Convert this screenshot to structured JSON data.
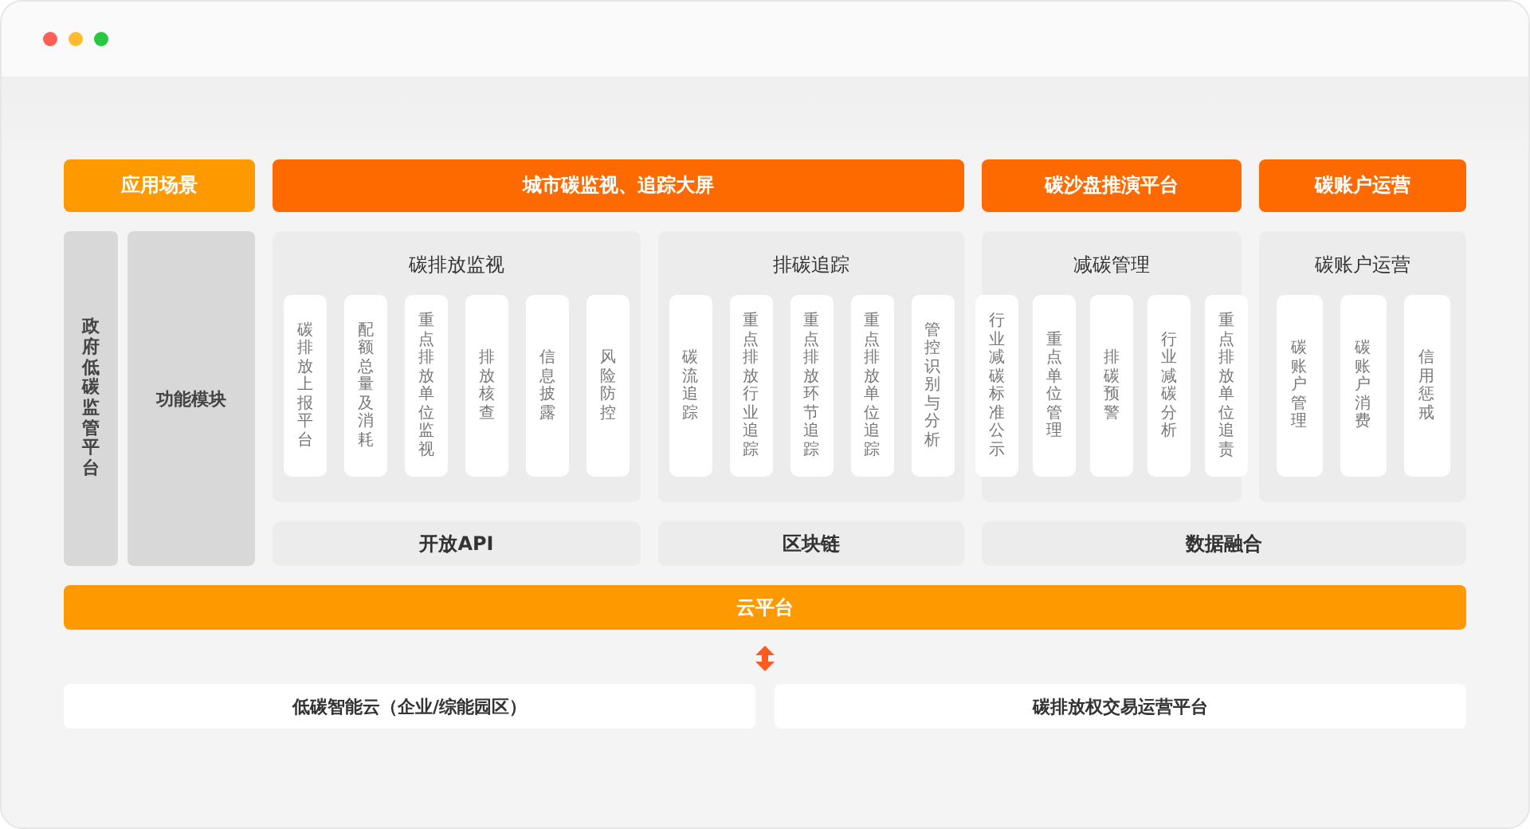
{
  "headers": [
    {
      "label": "应用场景",
      "color": "#ff9900"
    },
    {
      "label": "城市碳监视、追踪大屏",
      "color": "#ff6a00"
    },
    {
      "label": "碳沙盘推演平台",
      "color": "#ff6a00"
    },
    {
      "label": "碳账户运营",
      "color": "#ff6a00"
    }
  ],
  "side": {
    "platform": "政府低碳监管平台",
    "module": "功能模块"
  },
  "panels": [
    {
      "title": "碳排放监视",
      "items": [
        "碳排放上报平台",
        "配额总量及消耗",
        "重点排放单位监视",
        "排放核查",
        "信息披露",
        "风险防控"
      ]
    },
    {
      "title": "排碳追踪",
      "items": [
        "碳流追踪",
        "重点排放行业追踪",
        "重点排放环节追踪",
        "重点排放单位追踪",
        "管控识别与分析"
      ]
    },
    {
      "title": "减碳管理",
      "items": [
        "行业减碳标准公示",
        "重点单位管理",
        "排碳预警",
        "行业减碳分析",
        "重点排放单位追责"
      ]
    },
    {
      "title": "碳账户运营",
      "items": [
        "碳账户管理",
        "碳账户消费",
        "信用惩戒"
      ]
    }
  ],
  "foundations": [
    "开放API",
    "区块链",
    "数据融合"
  ],
  "cloud": "云平台",
  "bottom": [
    "低碳智能云（企业/综能园区）",
    "碳排放权交易运营平台"
  ]
}
